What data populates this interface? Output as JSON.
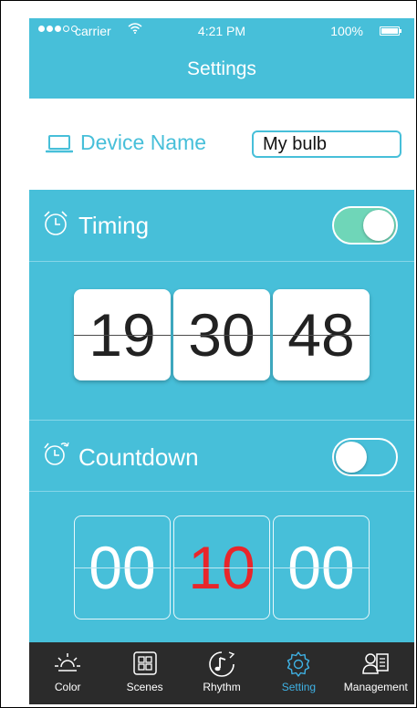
{
  "status_bar": {
    "carrier": "carrier",
    "time": "4:21 PM",
    "battery": "100%"
  },
  "nav": {
    "title": "Settings"
  },
  "device": {
    "icon": "laptop-icon",
    "label": "Device Name",
    "value": "My bulb"
  },
  "timing": {
    "icon": "alarm-clock-icon",
    "label": "Timing",
    "enabled": true,
    "hours": "19",
    "minutes": "30",
    "seconds": "48"
  },
  "countdown": {
    "icon": "alarm-clock-repeat-icon",
    "label": "Countdown",
    "enabled": false,
    "hours": "00",
    "minutes": "10",
    "seconds": "00"
  },
  "tabs": [
    {
      "label": "Color",
      "icon": "sun-icon",
      "active": false
    },
    {
      "label": "Scenes",
      "icon": "grid-icon",
      "active": false
    },
    {
      "label": "Rhythm",
      "icon": "music-note-icon",
      "active": false
    },
    {
      "label": "Setting",
      "icon": "gear-icon",
      "active": true
    },
    {
      "label": "Management",
      "icon": "user-list-icon",
      "active": false
    }
  ],
  "colors": {
    "accent": "#47bfd9",
    "toggle_on": "#6fd6b8",
    "tab_bar": "#2b2b2b",
    "tab_active": "#3fb2e5",
    "countdown_minutes": "#e8262b"
  }
}
